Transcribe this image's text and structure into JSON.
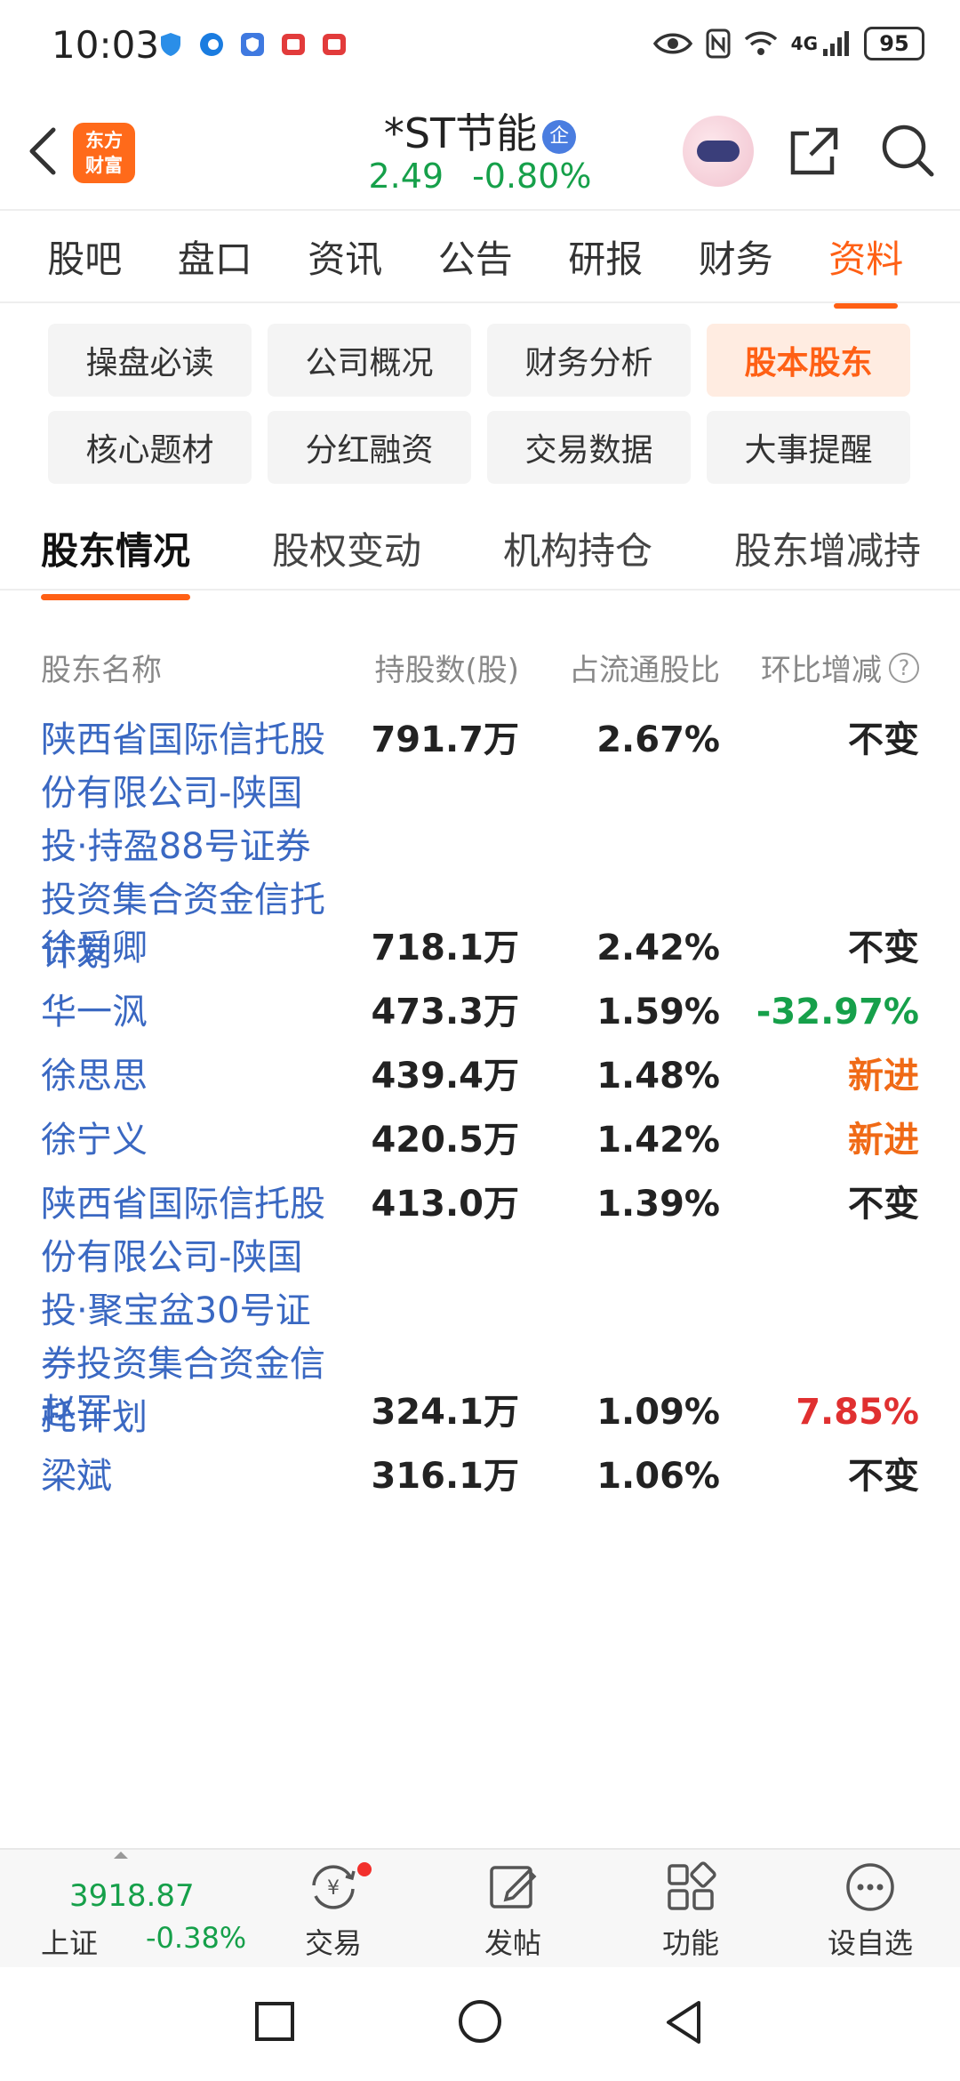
{
  "status_bar": {
    "time": "10:03",
    "network": "4G",
    "battery": "95"
  },
  "header": {
    "brand_line1": "东方",
    "brand_line2": "财富",
    "stock_name": "*ST节能",
    "badge": "企",
    "price": "2.49",
    "change_pct": "-0.80%"
  },
  "main_tabs": [
    {
      "label": "股吧"
    },
    {
      "label": "盘口"
    },
    {
      "label": "资讯"
    },
    {
      "label": "公告"
    },
    {
      "label": "研报"
    },
    {
      "label": "财务"
    },
    {
      "label": "资料",
      "active": true
    }
  ],
  "chips": [
    {
      "label": "操盘必读"
    },
    {
      "label": "公司概况"
    },
    {
      "label": "财务分析"
    },
    {
      "label": "股本股东",
      "active": true
    },
    {
      "label": "核心题材"
    },
    {
      "label": "分红融资"
    },
    {
      "label": "交易数据"
    },
    {
      "label": "大事提醒"
    }
  ],
  "sub_tabs": [
    {
      "label": "股东情况",
      "active": true
    },
    {
      "label": "股权变动"
    },
    {
      "label": "机构持仓"
    },
    {
      "label": "股东增减持"
    }
  ],
  "table": {
    "headers": {
      "name": "股东名称",
      "shares": "持股数(股)",
      "ratio": "占流通股比",
      "change": "环比增减",
      "help": "?"
    },
    "rows": [
      {
        "name": "陕西省国际信托股份有限公司-陕国投·持盈88号证券投资集合资金信托计划",
        "shares": "791.7万",
        "ratio": "2.67%",
        "change": "不变",
        "trend": "flat"
      },
      {
        "name": "徐爱卿",
        "shares": "718.1万",
        "ratio": "2.42%",
        "change": "不变",
        "trend": "flat"
      },
      {
        "name": "华一沨",
        "shares": "473.3万",
        "ratio": "1.59%",
        "change": "-32.97%",
        "trend": "down"
      },
      {
        "name": "徐思思",
        "shares": "439.4万",
        "ratio": "1.48%",
        "change": "新进",
        "trend": "new"
      },
      {
        "name": "徐宁义",
        "shares": "420.5万",
        "ratio": "1.42%",
        "change": "新进",
        "trend": "new"
      },
      {
        "name": "陕西省国际信托股份有限公司-陕国投·聚宝盆30号证券投资集合资金信托计划",
        "shares": "413.0万",
        "ratio": "1.39%",
        "change": "不变",
        "trend": "flat"
      },
      {
        "name": "赵军",
        "shares": "324.1万",
        "ratio": "1.09%",
        "change": "7.85%",
        "trend": "up"
      },
      {
        "name": "梁斌",
        "shares": "316.1万",
        "ratio": "1.06%",
        "change": "不变",
        "trend": "flat"
      }
    ]
  },
  "bottom_nav": {
    "index_value": "3918.87",
    "index_name": "上证",
    "index_change": "-0.38%",
    "items": [
      {
        "label": "交易",
        "icon": "trade-icon"
      },
      {
        "label": "发帖",
        "icon": "post-icon"
      },
      {
        "label": "功能",
        "icon": "apps-icon"
      },
      {
        "label": "设自选",
        "icon": "more-icon"
      }
    ]
  },
  "colors": {
    "accent": "#ff6015",
    "link": "#3a68c2",
    "rise": "#e03030",
    "fall": "#16a04a",
    "new": "#f06a16"
  }
}
